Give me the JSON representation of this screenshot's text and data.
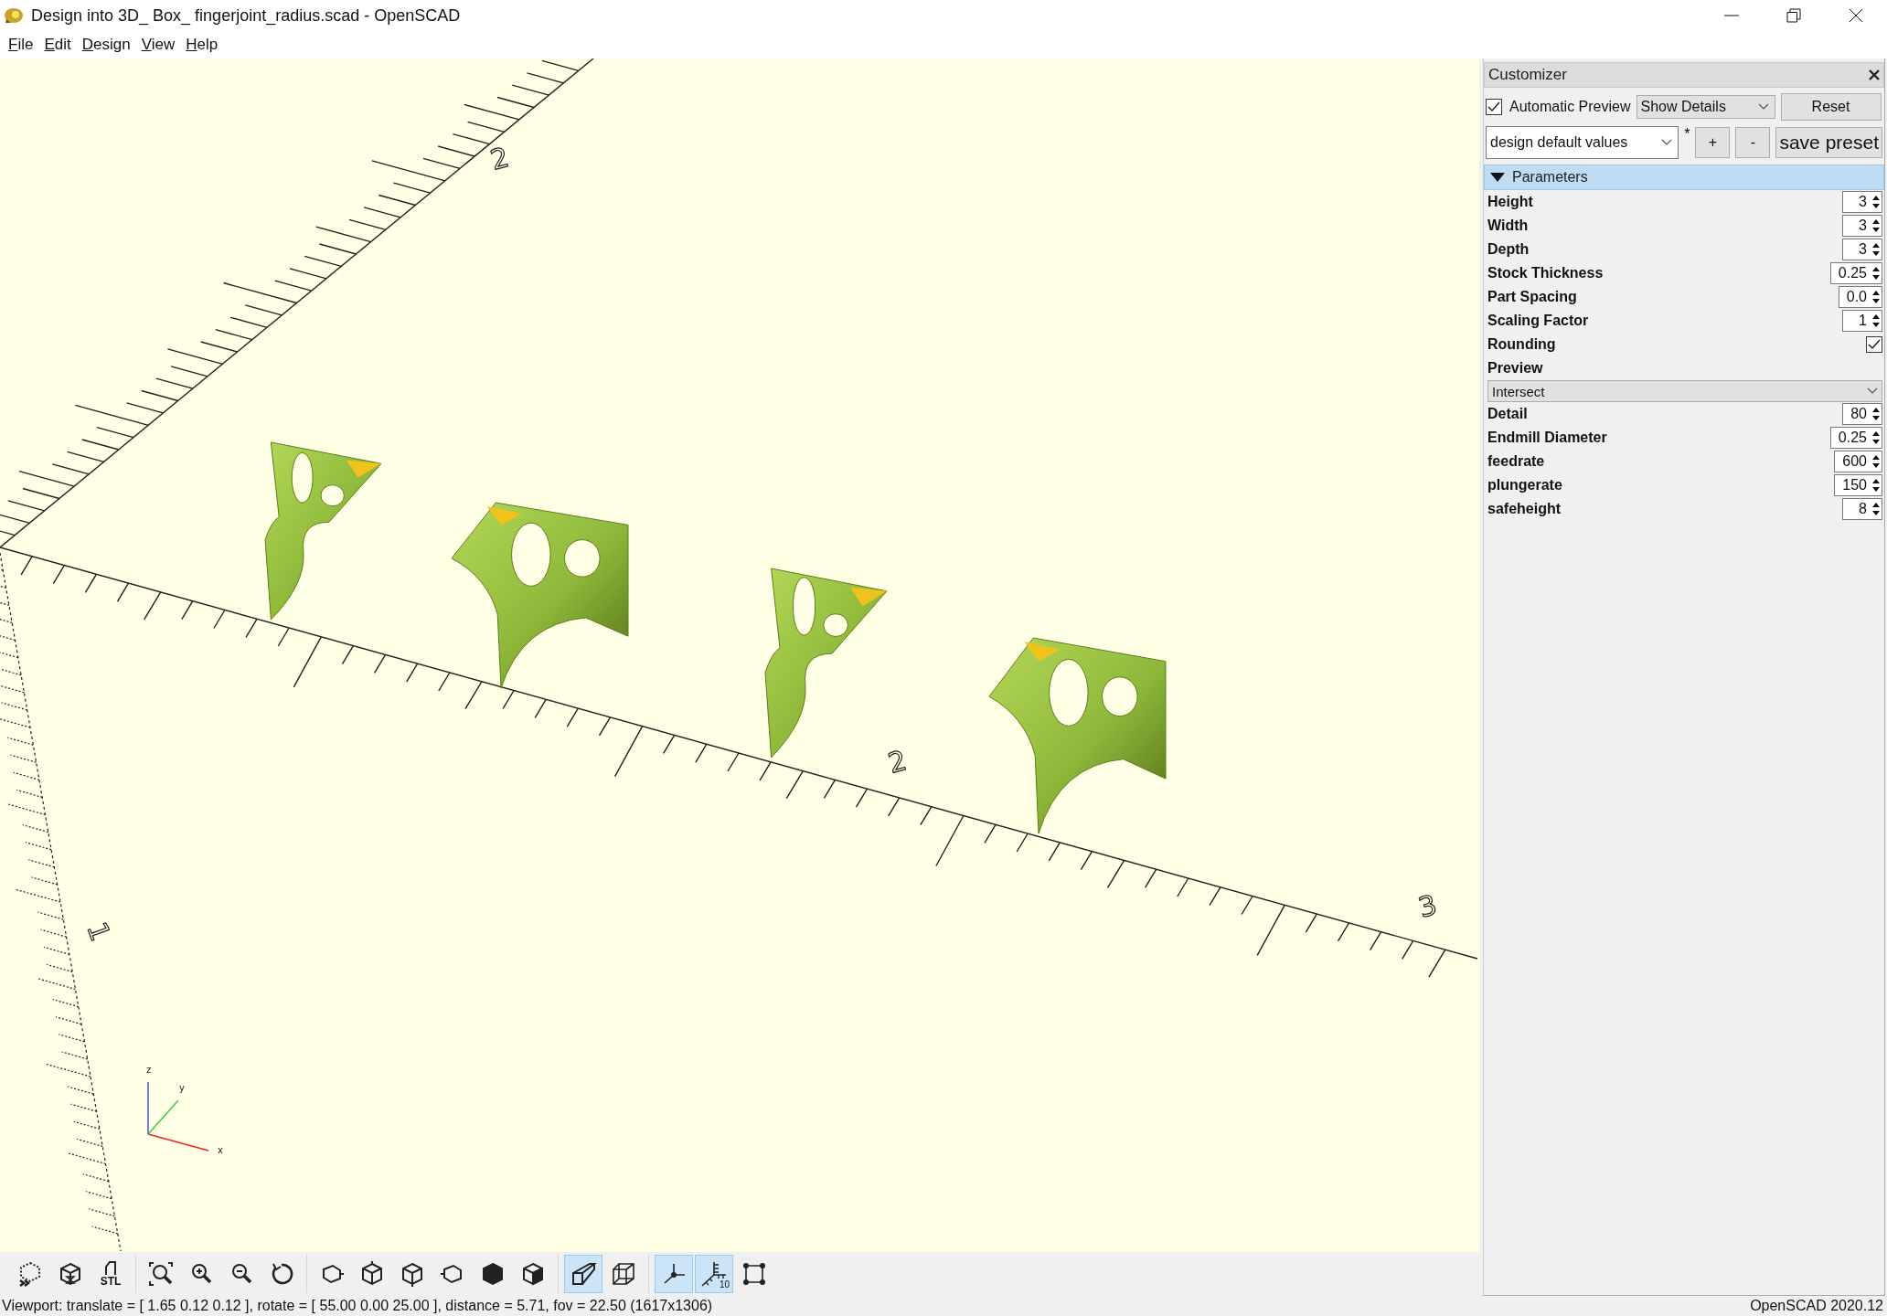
{
  "window": {
    "title": "Design into 3D_ Box_ fingerjoint_radius.scad - OpenSCAD"
  },
  "menu": [
    "File",
    "Edit",
    "Design",
    "View",
    "Help"
  ],
  "viewport": {
    "scale_labels": [
      "2",
      "2",
      "3",
      "1"
    ],
    "axis_labels": [
      "z",
      "y",
      "x"
    ]
  },
  "toolbar": {
    "groups": [
      [
        {
          "selected": false
        },
        {
          "selected": false
        },
        {
          "label": "STL",
          "selected": false
        }
      ],
      [
        {
          "selected": false
        },
        {
          "selected": false
        },
        {
          "selected": false
        },
        {
          "selected": false
        }
      ],
      [
        {
          "selected": false
        },
        {
          "selected": false
        },
        {
          "selected": false
        },
        {
          "selected": false
        },
        {
          "selected": false
        },
        {
          "selected": false
        }
      ],
      [
        {
          "selected": true
        },
        {
          "selected": false
        }
      ],
      [
        {
          "selected": true
        },
        {
          "label": "10",
          "selected": true
        },
        {
          "selected": false
        }
      ]
    ]
  },
  "customizer": {
    "title": "Customizer",
    "automatic_preview": {
      "label": "Automatic Preview",
      "checked": true
    },
    "details_select": "Show Details",
    "reset": "Reset",
    "preset_select": "design default values",
    "modified_mark": "*",
    "add_preset": "+",
    "remove_preset": "-",
    "save_preset": "save preset",
    "section": {
      "title": "Parameters",
      "expanded": true
    },
    "params": [
      {
        "kind": "number",
        "label": "Height",
        "value": "3"
      },
      {
        "kind": "number",
        "label": "Width",
        "value": "3"
      },
      {
        "kind": "number",
        "label": "Depth",
        "value": "3"
      },
      {
        "kind": "number",
        "label": "Stock Thickness",
        "value": "0.25"
      },
      {
        "kind": "number",
        "label": "Part Spacing",
        "value": "0.0"
      },
      {
        "kind": "number",
        "label": "Scaling Factor",
        "value": "1"
      },
      {
        "kind": "checkbox",
        "label": "Rounding",
        "checked": true
      },
      {
        "kind": "select",
        "label": "Preview",
        "value": "Intersect"
      },
      {
        "kind": "number",
        "label": "Detail",
        "value": "80"
      },
      {
        "kind": "number",
        "label": "Endmill Diameter",
        "value": "0.25"
      },
      {
        "kind": "number",
        "label": "feedrate",
        "value": "600"
      },
      {
        "kind": "number",
        "label": "plungerate",
        "value": "150"
      },
      {
        "kind": "number",
        "label": "safeheight",
        "value": "8"
      }
    ]
  },
  "status_bar": {
    "viewport": "Viewport: translate = [ 1.65 0.12 0.12 ], rotate = [ 55.00 0.00 25.00 ], distance = 5.71, fov = 22.50 (1617x1306)",
    "version": "OpenSCAD 2020.12"
  }
}
